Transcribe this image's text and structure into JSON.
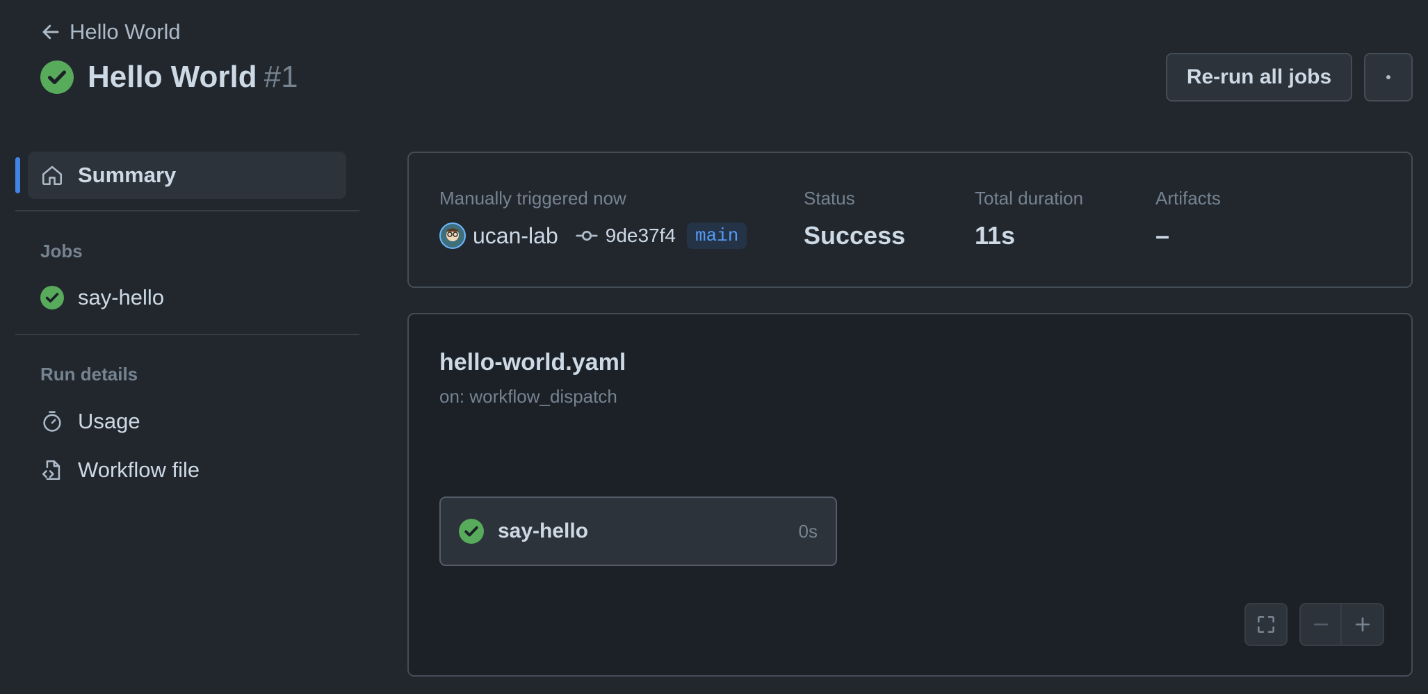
{
  "header": {
    "back_label": "Hello World",
    "title": "Hello World",
    "run_number": "#1",
    "rerun_label": "Re-run all jobs"
  },
  "sidebar": {
    "summary_label": "Summary",
    "jobs_heading": "Jobs",
    "jobs": [
      {
        "label": "say-hello",
        "status": "success"
      }
    ],
    "run_details_heading": "Run details",
    "details": [
      {
        "label": "Usage",
        "icon": "stopwatch-icon"
      },
      {
        "label": "Workflow file",
        "icon": "file-code-icon"
      }
    ]
  },
  "summary": {
    "trigger_label": "Manually triggered now",
    "actor": "ucan-lab",
    "commit_sha": "9de37f4",
    "branch": "main",
    "status_label": "Status",
    "status_value": "Success",
    "duration_label": "Total duration",
    "duration_value": "11s",
    "artifacts_label": "Artifacts",
    "artifacts_value": "–"
  },
  "graph": {
    "workflow_name": "hello-world.yaml",
    "trigger": "on: workflow_dispatch",
    "job": {
      "name": "say-hello",
      "duration": "0s",
      "status": "success"
    }
  },
  "colors": {
    "success": "#57ab5a",
    "accent": "#4184e4",
    "branch_text": "#539bf5"
  }
}
